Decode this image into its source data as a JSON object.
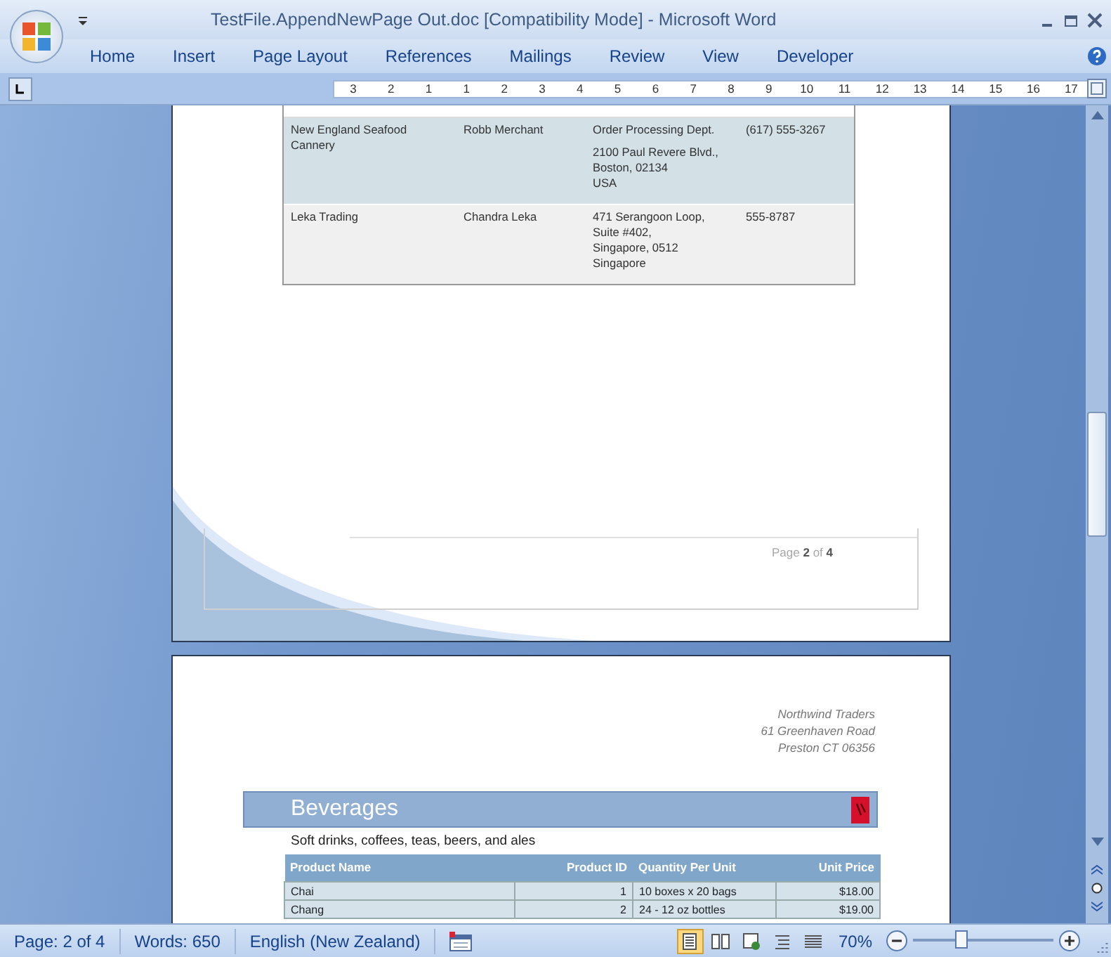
{
  "window": {
    "title": "TestFile.AppendNewPage Out.doc [Compatibility Mode] - Microsoft Word"
  },
  "ribbon_tabs": [
    {
      "label": "Home",
      "selected": false
    },
    {
      "label": "Insert",
      "selected": false
    },
    {
      "label": "Page Layout",
      "selected": false
    },
    {
      "label": "References",
      "selected": false
    },
    {
      "label": "Mailings",
      "selected": false
    },
    {
      "label": "Review",
      "selected": false
    },
    {
      "label": "View",
      "selected": false
    },
    {
      "label": "Developer",
      "selected": false
    }
  ],
  "ruler": {
    "labels": [
      "3",
      "2",
      "1",
      "1",
      "2",
      "3",
      "4",
      "5",
      "6",
      "7",
      "8",
      "9",
      "10",
      "11",
      "12",
      "13",
      "14",
      "15",
      "16",
      "17"
    ]
  },
  "page_1": {
    "table_rows": [
      {
        "cells": [
          [
            "New England Seafood Cannery"
          ],
          [
            "Robb Merchant"
          ],
          [
            "Order Processing Dept.",
            "2100 Paul Revere Blvd.,\nBoston, 02134\nUSA"
          ],
          [
            "(617) 555-3267"
          ]
        ]
      },
      {
        "cells": [
          [
            "Leka Trading"
          ],
          [
            "Chandra Leka"
          ],
          [
            "471 Serangoon Loop,\nSuite #402,\nSingapore, 0512\nSingapore"
          ],
          [
            "555-8787"
          ]
        ]
      }
    ],
    "footer": "Page **2** of **4**"
  },
  "page_2": {
    "address": [
      "Northwind Traders",
      "61 Greenhaven Road",
      "Preston CT 06356"
    ],
    "section": {
      "title": "Beverages",
      "description": "Soft drinks, coffees, teas, beers, and ales"
    },
    "table": {
      "columns": [
        "Product Name",
        "Product ID",
        "Quantity Per Unit",
        "Unit Price"
      ],
      "rows": [
        [
          "Chai",
          "1",
          "10 boxes x 20 bags",
          "$18.00"
        ],
        [
          "Chang",
          "2",
          "24 - 12 oz bottles",
          "$19.00"
        ]
      ]
    }
  },
  "status_bar": {
    "page": "Page: 2 of 4",
    "words": "Words: 650",
    "language": "English (New Zealand)",
    "view_buttons": [
      {
        "selected": true
      },
      {
        "selected": false
      },
      {
        "selected": false
      },
      {
        "selected": false
      },
      {
        "selected": false
      }
    ],
    "zoom": {
      "reading": "70%",
      "level": 0.35
    }
  }
}
